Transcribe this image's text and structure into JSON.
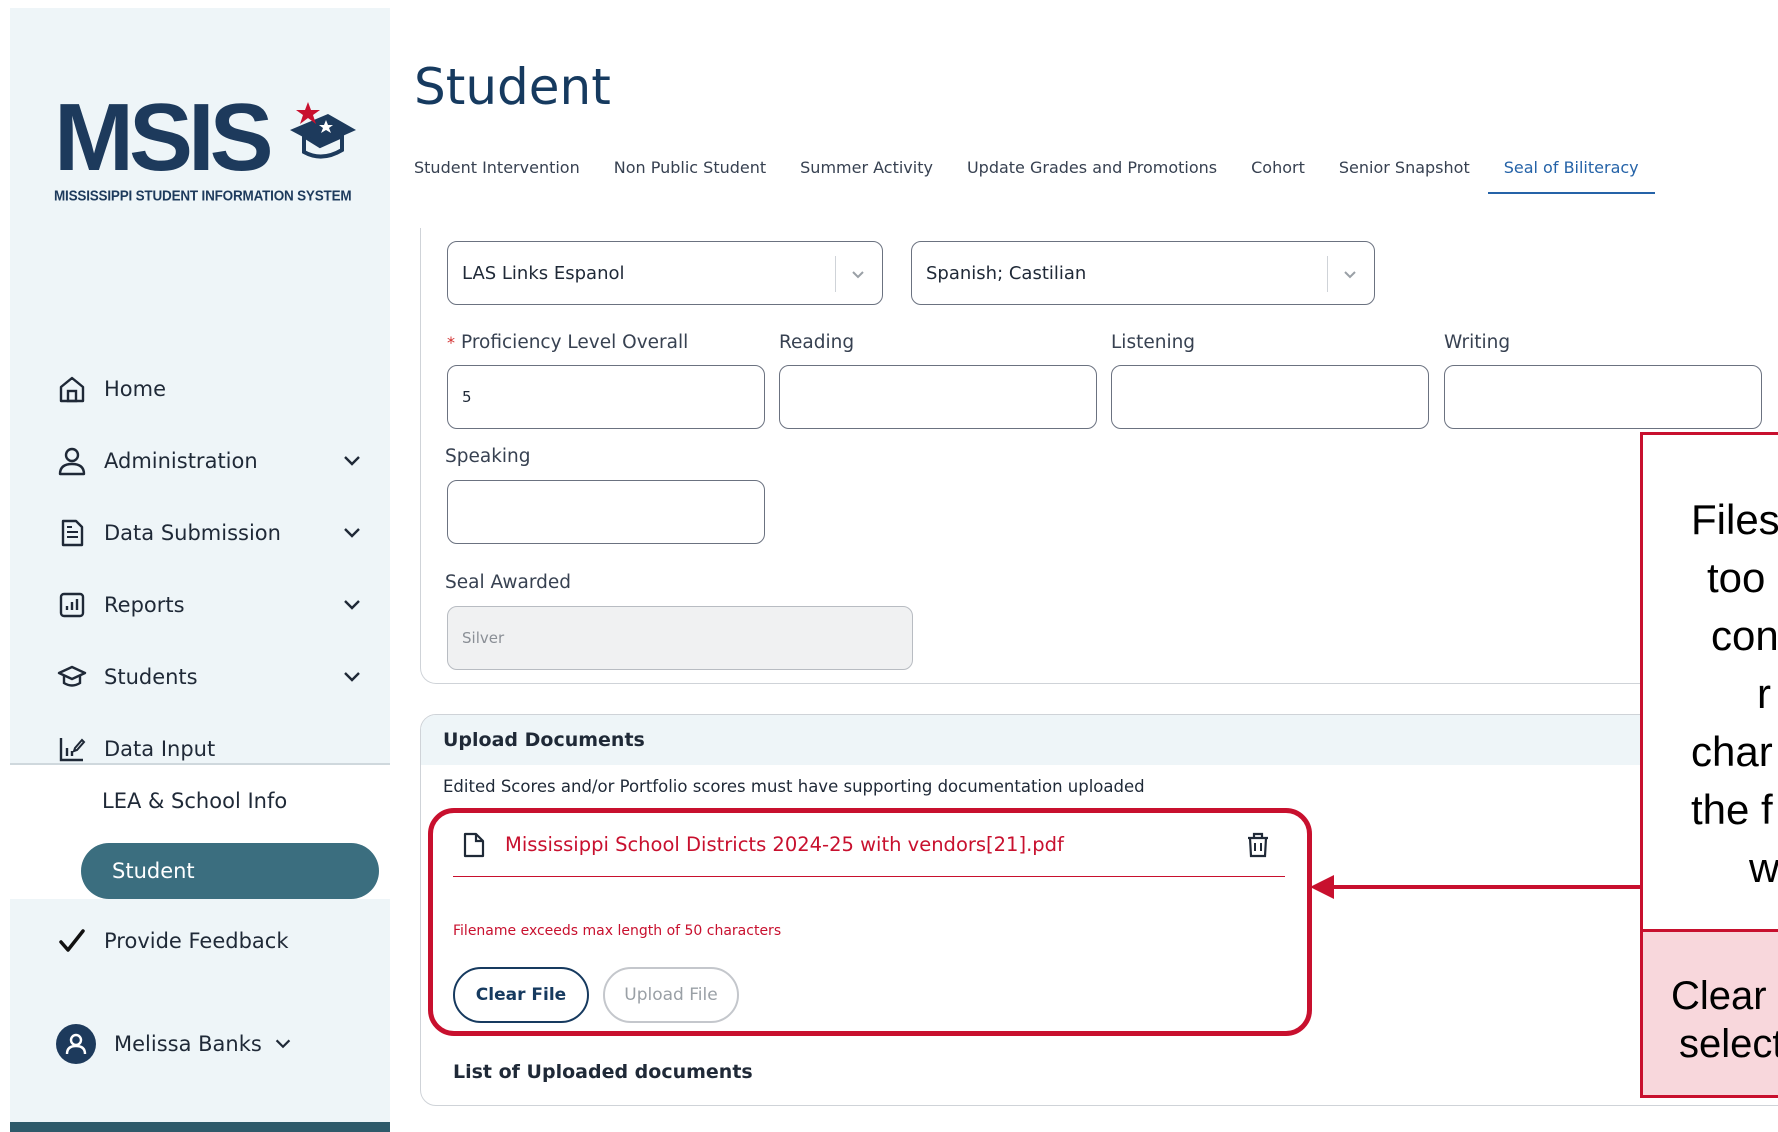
{
  "app": {
    "logo_text": "MSIS",
    "logo_subtitle": "MISSISSIPPI STUDENT INFORMATION SYSTEM"
  },
  "sidebar": {
    "items": [
      {
        "label": "Home",
        "icon": "home-icon"
      },
      {
        "label": "Administration",
        "icon": "person-icon"
      },
      {
        "label": "Data Submission",
        "icon": "document-icon"
      },
      {
        "label": "Reports",
        "icon": "chart-icon"
      },
      {
        "label": "Students",
        "icon": "graduation-cap-icon"
      },
      {
        "label": "Data Input",
        "icon": "data-input-icon"
      }
    ],
    "sub_items": [
      "LEA & School Info",
      "Student"
    ],
    "feedback_label": "Provide Feedback",
    "user_name": "Melissa Banks"
  },
  "page": {
    "title": "Student",
    "tabs": [
      "Student Intervention",
      "Non Public Student",
      "Summer Activity",
      "Update Grades and Promotions",
      "Cohort",
      "Senior Snapshot",
      "Seal of Biliteracy"
    ],
    "active_tab": "Seal of Biliteracy"
  },
  "form": {
    "assessment_value": "LAS Links Espanol",
    "language_value": "Spanish; Castilian",
    "proficiency_label": "Proficiency Level Overall",
    "proficiency_value": "5",
    "reading_label": "Reading",
    "listening_label": "Listening",
    "writing_label": "Writing",
    "speaking_label": "Speaking",
    "seal_label": "Seal Awarded",
    "seal_value": "Silver"
  },
  "upload": {
    "header": "Upload Documents",
    "note": "Edited Scores and/or Portfolio scores must have supporting documentation uploaded",
    "file_name": "Mississippi School Districts 2024-25 with vendors[21].pdf",
    "error": "Filename exceeds max length of 50 characters",
    "clear_label": "Clear File",
    "upload_label": "Upload File",
    "list_header": "List of Uploaded documents"
  },
  "annotation": {
    "lines": [
      "Files",
      "too",
      "con",
      "r",
      "char",
      "the f",
      "w"
    ],
    "action_lines": [
      "Clear",
      "select"
    ]
  },
  "colors": {
    "accent": "#163a5f",
    "active_nav": "#3b6e7f",
    "error": "#c8102e",
    "callout_fill": "#f8d7dc"
  }
}
